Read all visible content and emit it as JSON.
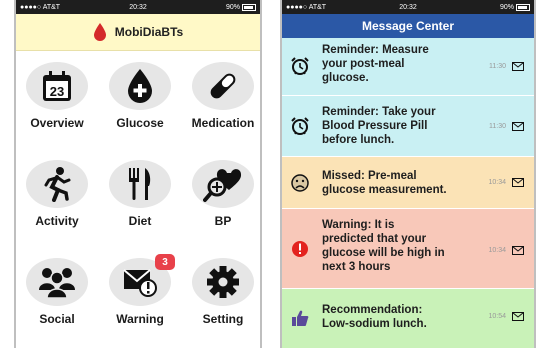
{
  "left_phone": {
    "status": {
      "carrier": "●●●●○ AT&T",
      "time": "20:32",
      "battery": "90%"
    },
    "app_title": "MobiDiaBTs",
    "tiles": [
      {
        "label": "Overview",
        "icon": "calendar-icon",
        "calendar_day": "23"
      },
      {
        "label": "Glucose",
        "icon": "blood-drop-plus-icon"
      },
      {
        "label": "Medication",
        "icon": "pill-icon"
      },
      {
        "label": "Activity",
        "icon": "running-person-icon"
      },
      {
        "label": "Diet",
        "icon": "fork-knife-icon"
      },
      {
        "label": "BP",
        "icon": "heart-magnifier-icon"
      },
      {
        "label": "Social",
        "icon": "group-people-icon"
      },
      {
        "label": "Warning",
        "icon": "warning-mail-icon",
        "badge": "3"
      },
      {
        "label": "Setting",
        "icon": "gear-icon"
      }
    ]
  },
  "right_phone": {
    "status": {
      "carrier": "●●●●○ AT&T",
      "time": "20:32",
      "battery": "90%"
    },
    "header_title": "Message Center",
    "messages": [
      {
        "text": "Reminder: Measure\nyour post-meal\nglucose.",
        "time": "11:30",
        "icon": "alarm-clock-icon",
        "color": "#c9f0f3"
      },
      {
        "text": "Reminder: Take your\nBlood Pressure Pill\nbefore lunch.",
        "time": "11:30",
        "icon": "alarm-clock-icon",
        "color": "#c9f0f3"
      },
      {
        "text": "Missed: Pre-meal\nglucose measurement.",
        "time": "10:34",
        "icon": "sad-face-icon",
        "color": "#fbe3b6"
      },
      {
        "text": "Warning: It is\npredicted that your\nglucose will be high in\nnext 3 hours",
        "time": "10:34",
        "icon": "exclamation-circle-icon",
        "color": "#f8c8b9"
      },
      {
        "text": "Recommendation:\nLow-sodium lunch.",
        "time": "10:54",
        "icon": "thumbs-up-icon",
        "color": "#c9f2b8"
      }
    ]
  },
  "colors": {
    "accent_blue": "#2b58a6",
    "header_yellow": "#fff9c7",
    "logo_red": "#d42a2a",
    "badge_red": "#e8414a"
  }
}
